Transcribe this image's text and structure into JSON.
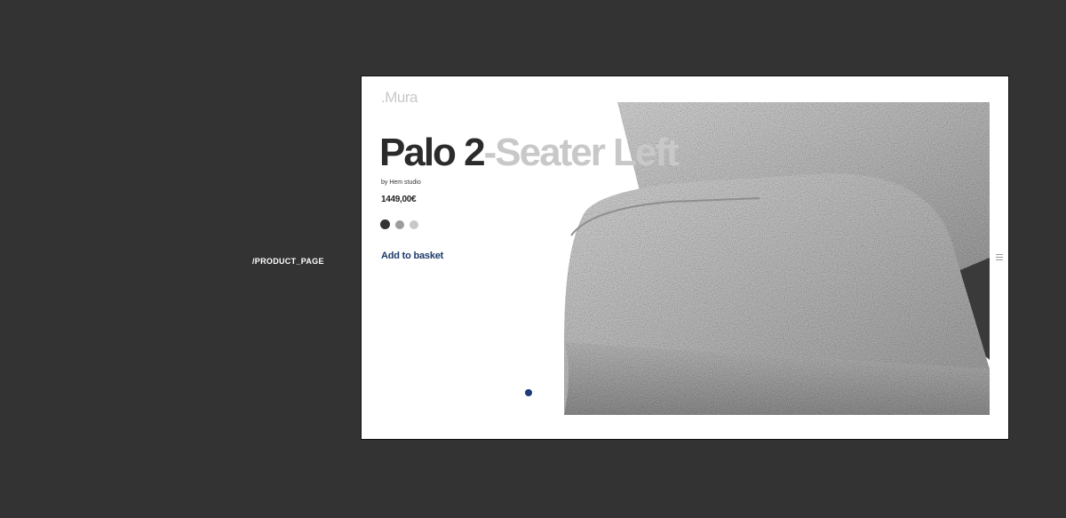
{
  "page": {
    "side_label": "/PRODUCT_PAGE"
  },
  "brand": {
    "logo": ".Mura"
  },
  "product": {
    "title_dark": "Palo 2",
    "title_light": "-Seater Left",
    "byline": "by Hem studio",
    "price": "1449,00€",
    "swatch_colors": [
      "#333333",
      "#9c9c9c",
      "#c9c9c9"
    ]
  },
  "actions": {
    "add_to_basket": "Add to basket"
  },
  "carousel": {
    "active_dot_color": "#1d3a7a"
  },
  "icons": {
    "menu": "menu-icon"
  },
  "colors": {
    "background": "#333333",
    "accent": "#1d3a6b"
  }
}
